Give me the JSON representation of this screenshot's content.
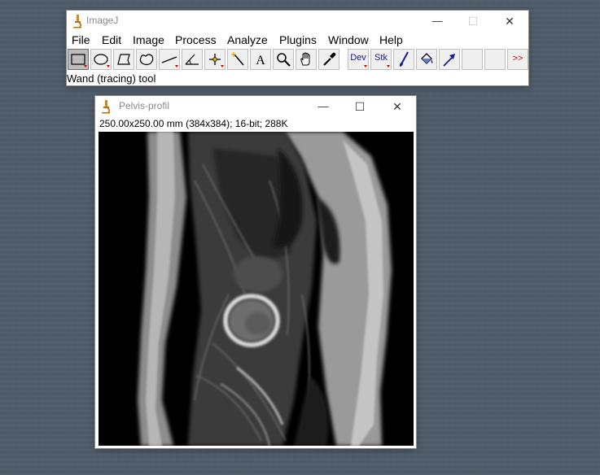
{
  "imagej_window": {
    "title": "ImageJ",
    "controls": {
      "minimize": "—",
      "maximize": "☐",
      "close": "✕"
    },
    "menu": [
      "File",
      "Edit",
      "Image",
      "Process",
      "Analyze",
      "Plugins",
      "Window",
      "Help"
    ],
    "toolbar": {
      "tools": [
        {
          "name": "rectangle-tool",
          "icon": "rectangle-icon",
          "selected": true
        },
        {
          "name": "oval-tool",
          "icon": "oval-icon"
        },
        {
          "name": "polygon-tool",
          "icon": "polygon-icon"
        },
        {
          "name": "freehand-tool",
          "icon": "freehand-icon"
        },
        {
          "name": "line-tool",
          "icon": "line-icon"
        },
        {
          "name": "angle-tool",
          "icon": "angle-icon"
        },
        {
          "name": "point-tool",
          "icon": "point-icon"
        },
        {
          "name": "wand-tool",
          "icon": "wand-icon"
        },
        {
          "name": "text-tool",
          "icon": "text-icon"
        },
        {
          "name": "zoom-tool",
          "icon": "magnifier-icon"
        },
        {
          "name": "hand-tool",
          "icon": "hand-icon"
        },
        {
          "name": "color-picker-tool",
          "icon": "eyedropper-icon"
        }
      ],
      "dev_label": "Dev",
      "stk_label": "Stk",
      "more_label": ">>"
    },
    "status": "Wand (tracing) tool"
  },
  "image_window": {
    "title": "Pelvis-profil",
    "controls": {
      "minimize": "—",
      "maximize": "☐",
      "close": "✕"
    },
    "info": "250.00x250.00 mm (384x384); 16-bit; 288K",
    "image_description": "sagittal MRI pelvis"
  },
  "colors": {
    "desktop": "#4f5d6a",
    "accent_red": "#cc0000",
    "icon_blue": "#1a1a8a"
  }
}
